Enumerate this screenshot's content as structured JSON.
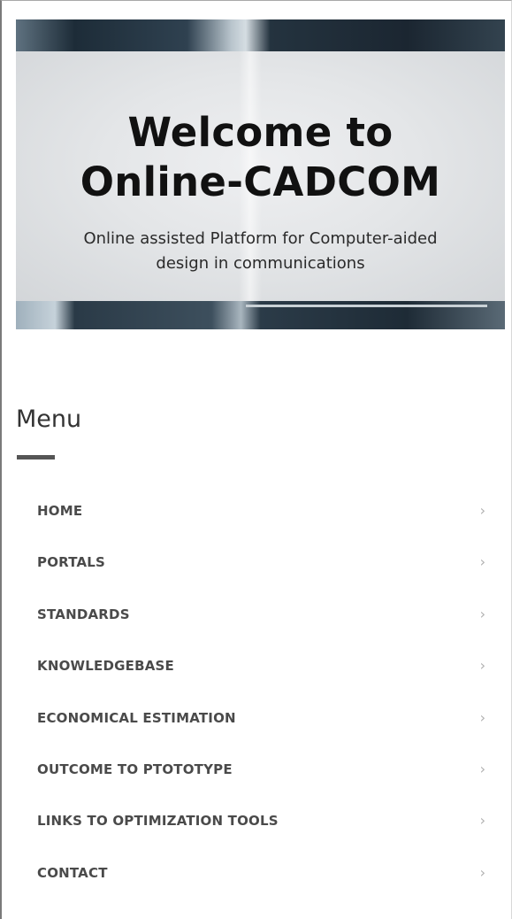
{
  "hero": {
    "title_line1": "Welcome to",
    "title_line2": "Online-CADCOM",
    "subtitle_line1": "Online assisted Platform for Computer-aided",
    "subtitle_line2": "design in communications"
  },
  "menu": {
    "heading": "Menu",
    "chevron_icon": "chevron-right-icon",
    "items": [
      {
        "label": "HOME",
        "chevron": "›"
      },
      {
        "label": "PORTALS",
        "chevron": "›"
      },
      {
        "label": "STANDARDS",
        "chevron": "›"
      },
      {
        "label": "KNOWLEDGEBASE",
        "chevron": "›"
      },
      {
        "label": "ECONOMICAL ESTIMATION",
        "chevron": "›"
      },
      {
        "label": "OUTCOME TO PTOTOTYPE",
        "chevron": "›"
      },
      {
        "label": "LINKS TO OPTIMIZATION TOOLS",
        "chevron": "›"
      },
      {
        "label": "CONTACT",
        "chevron": "›"
      }
    ]
  },
  "colors": {
    "heading_text": "#333333",
    "menu_text": "#4a4a4a",
    "chevron": "#b0b0b0",
    "underline": "#555555"
  }
}
